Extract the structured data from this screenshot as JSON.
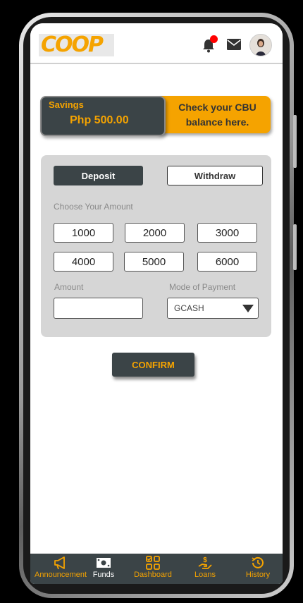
{
  "header": {
    "logo_text": "COOP",
    "icons": [
      "bell-icon",
      "mail-icon",
      "avatar"
    ],
    "has_notification": true
  },
  "balance": {
    "label": "Savings",
    "amount": "Php 500.00",
    "cta": "Check your CBU balance here."
  },
  "form": {
    "tabs": {
      "deposit": "Deposit",
      "withdraw": "Withdraw"
    },
    "choose_label": "Choose Your Amount",
    "amounts": [
      "1000",
      "2000",
      "3000",
      "4000",
      "5000",
      "6000"
    ],
    "amount_label": "Amount",
    "amount_value": "",
    "mode_label": "Mode of Payment",
    "mode_selected": "GCASH"
  },
  "confirm_label": "CONFIRM",
  "nav": {
    "items": [
      {
        "label": "Announcement",
        "icon": "megaphone-icon",
        "active": false
      },
      {
        "label": "Funds",
        "icon": "money-icon",
        "active": true
      },
      {
        "label": "Dashboard",
        "icon": "dashboard-icon",
        "active": false
      },
      {
        "label": "Loans",
        "icon": "loan-hand-icon",
        "active": false
      },
      {
        "label": "History",
        "icon": "history-icon",
        "active": false
      }
    ]
  },
  "colors": {
    "accent": "#f5a300",
    "dark": "#3b4447",
    "panel": "#d6d6d6",
    "notification": "#ff0000"
  }
}
